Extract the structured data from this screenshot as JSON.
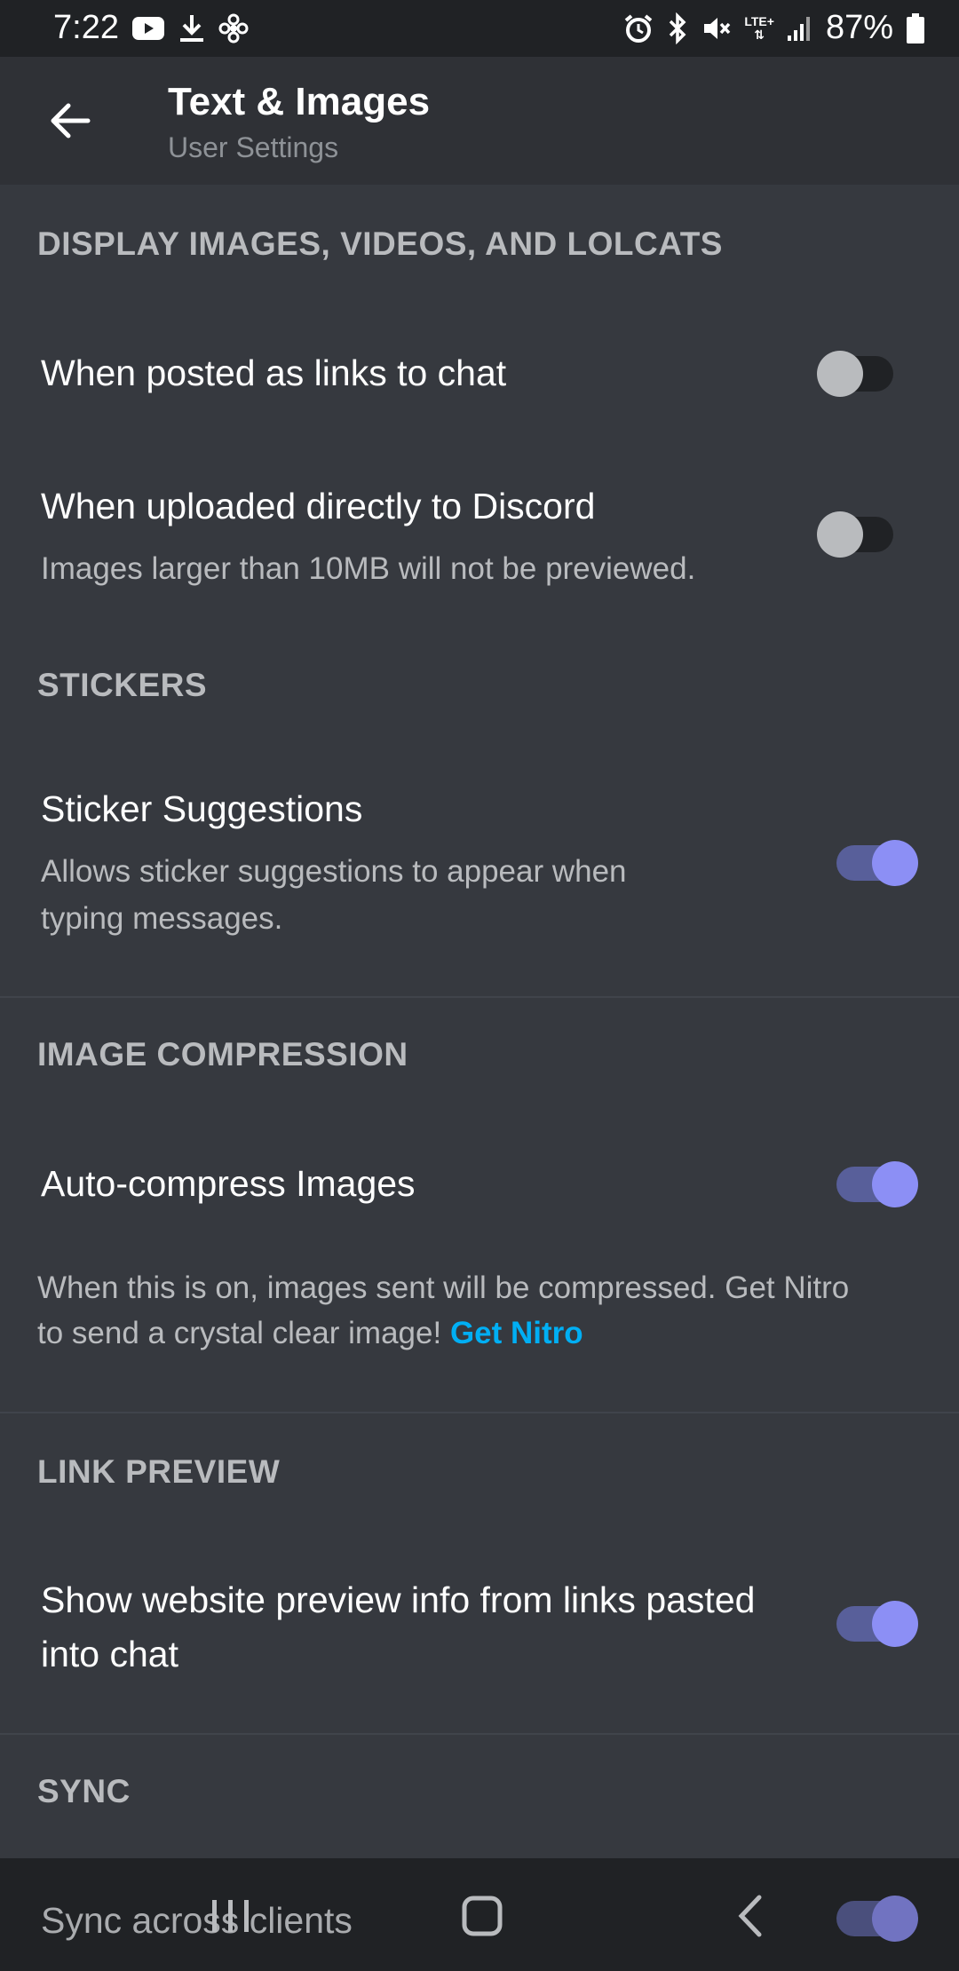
{
  "status_bar": {
    "time": "7:22",
    "battery": "87%",
    "network": "LTE+",
    "icons_left": [
      "youtube-icon",
      "download-icon",
      "fan-icon"
    ],
    "icons_right": [
      "alarm-icon",
      "bluetooth-icon",
      "mute-icon",
      "lte-icon",
      "signal-icon",
      "battery-icon"
    ]
  },
  "header": {
    "title": "Text & Images",
    "subtitle": "User Settings"
  },
  "sections": {
    "display": {
      "header": "DISPLAY IMAGES, VIDEOS, AND LOLCATS",
      "links_label": "When posted as links to chat",
      "links_enabled": false,
      "uploads_label": "When uploaded directly to Discord",
      "uploads_desc": "Images larger than 10MB will not be previewed.",
      "uploads_enabled": false
    },
    "stickers": {
      "header": "STICKERS",
      "suggestions_label": "Sticker Suggestions",
      "suggestions_desc_line1": "Allows sticker suggestions to appear when",
      "suggestions_desc_line2": "typing messages.",
      "suggestions_enabled": true
    },
    "compression": {
      "header": "IMAGE COMPRESSION",
      "auto_label": "Auto-compress Images",
      "auto_enabled": true,
      "note_line1": "When this is on, images sent will be compressed. Get Nitro",
      "note_line2": "to send a crystal clear image!",
      "note_link": "Get Nitro"
    },
    "link_preview": {
      "header": "LINK PREVIEW",
      "show_label_line1": "Show website preview info from links pasted",
      "show_label_line2": "into chat",
      "show_enabled": true
    },
    "sync": {
      "header": "SYNC",
      "sync_label": "Sync across clients",
      "sync_enabled": true
    }
  },
  "colors": {
    "background": "#36393f",
    "header_bg": "#2f3136",
    "status_bg": "#202225",
    "accent": "#8c8ff5",
    "link": "#00aff4"
  }
}
